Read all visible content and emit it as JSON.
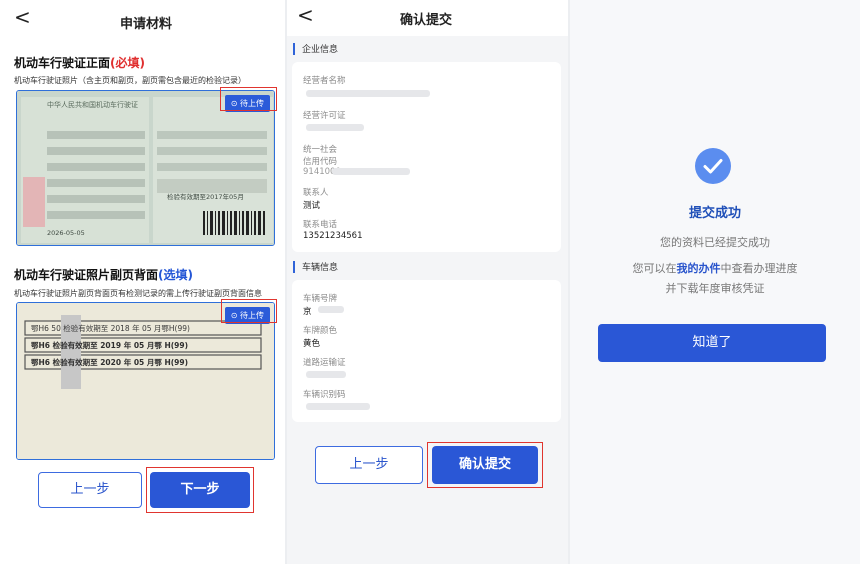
{
  "panel1": {
    "nav_back": "<",
    "nav_title": "申请材料",
    "front": {
      "title_main": "机动车行驶证正面",
      "title_tag": "(必填)",
      "desc": "机动车行驶证照片（含主页和副页，副页需包含最近的检验记录）",
      "badge": "⊙ 待上传",
      "photo_texts": [
        "中华人民共和国机动车行驶证",
        "检验有效期至2017年05月",
        "2026-05-05"
      ]
    },
    "back": {
      "title_main": "机动车行驶证照片副页背面",
      "title_tag": "(选填)",
      "desc": "机动车行驶证照片副页背面页有检测记录的需上传行驶证副页背面信息",
      "badge": "⊙ 待上传",
      "stamps": [
        "鄂H6  50 检验有效期至 2018 年 05 月鄂H(99)",
        "鄂H6  检验有效期至 2019 年 05 月鄂 H(99)",
        "鄂H6  检验有效期至 2020 年 05 月鄂 H(99)"
      ]
    },
    "prev_label": "上一步",
    "next_label": "下一步"
  },
  "panel2": {
    "nav_back": "<",
    "nav_title": "确认提交",
    "company_header": "企业信息",
    "company_fields": {
      "operator_label": "经营者名称",
      "license_label": "经营许可证",
      "credit_label_1": "统一社会",
      "credit_label_2": "信用代码",
      "credit_value": "9141000",
      "contact_label": "联系人",
      "contact_value": "测试",
      "phone_label": "联系电话",
      "phone_value": "13521234561"
    },
    "vehicle_header": "车辆信息",
    "vehicle_fields": {
      "plate_label": "车辆号牌",
      "plate_value": "京",
      "color_label": "车牌颜色",
      "color_value": "黄色",
      "transport_label": "道路运输证",
      "vin_label": "车辆识别码"
    },
    "prev_label": "上一步",
    "submit_label": "确认提交"
  },
  "panel3": {
    "title": "提交成功",
    "subtitle": "您的资料已经提交成功",
    "line1_pre": "您可以在",
    "line1_link": "我的办件",
    "line1_post": "中查看办理进度",
    "line2": "并下载年度审核凭证",
    "button_label": "知道了"
  },
  "colors": {
    "primary": "#2a57d6",
    "highlight": "#e0352f",
    "required": "#e02f2f",
    "optional": "#2456d6",
    "success_icon": "#5b8def"
  },
  "icons": {
    "back": "chevron-left-icon",
    "upload": "clock-icon",
    "success": "check-circle-icon"
  }
}
